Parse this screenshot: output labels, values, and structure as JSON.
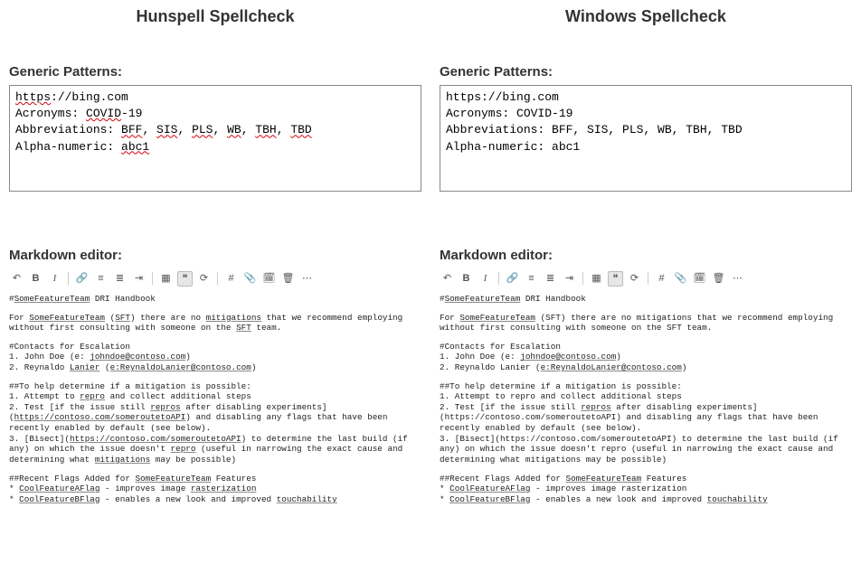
{
  "left": {
    "title": "Hunspell Spellcheck",
    "generic_label": "Generic Patterns:",
    "box": {
      "url_pre": "https",
      "url_post": "://bing.com",
      "acronyms_label": "Acronyms: ",
      "acr_word": "COVID",
      "acr_tail": "-19",
      "abbr_label": "Abbreviations: ",
      "abbr_bff": "BFF",
      "abbr_sis": "SIS",
      "abbr_pls": "PLS",
      "abbr_wb": "WB",
      "abbr_tbh": "TBH",
      "abbr_tbd": "TBD",
      "alpha_label": "Alpha-numeric: ",
      "alpha_val": "abc1"
    },
    "md_label": "Markdown editor:",
    "md": {
      "h1_pre": "#",
      "h1_team": "SomeFeatureTeam",
      "h1_rest": " DRI Handbook",
      "p1_a": "For ",
      "p1_team": "SomeFeatureTeam",
      "p1_b": " (",
      "p1_sft": "SFT",
      "p1_c": ") there are no ",
      "p1_mit": "mitigations",
      "p1_d": " that we recommend employing without first consulting with someone on the ",
      "p1_sft2": "SFT",
      "p1_e": " team.",
      "h2": "#Contacts for Escalation",
      "c1_a": "1. John Doe (e: ",
      "c1_mail": "johndoe@contoso.com",
      "c1_b": ")",
      "c2_a": "2. Reynaldo ",
      "c2_lanier": "Lanier",
      "c2_b": " (",
      "c2_mail": "e:ReynaldoLanier@contoso.com",
      "c2_c": ")",
      "h3": "##To help determine if a mitigation is possible:",
      "s1_a": "1. Attempt to ",
      "s1_repro": "repro",
      "s1_b": " and collect additional steps",
      "s2_a": "2. Test [if the issue still ",
      "s2_repros": "repros",
      "s2_b": " after disabling experiments](",
      "s2_url": "https://contoso.com/someroutetoAPI",
      "s2_c": ") and disabling any flags that have been recently enabled by default (see below).",
      "s3_a": "3. [Bisect](",
      "s3_url": "https://contoso.com/someroutetoAPI",
      "s3_b": ") to determine the last build (if any) on which the issue doesn't ",
      "s3_repro": "repro",
      "s3_c": " (useful in narrowing the exact cause and determining what ",
      "s3_mit": "mitigations",
      "s3_d": " may be possible)",
      "h4_a": "##Recent Flags Added for ",
      "h4_team": "SomeFeatureTeam",
      "h4_b": " Features",
      "f1_a": "* ",
      "f1_flag": "CoolFeatureAFlag",
      "f1_b": " - improves image ",
      "f1_rast": "rasterization",
      "f2_a": "* ",
      "f2_flag": "CoolFeatureBFlag",
      "f2_b": " - enables a new look and improved ",
      "f2_touch": "touchability"
    }
  },
  "right": {
    "title": "Windows Spellcheck",
    "generic_label": "Generic Patterns:",
    "box": {
      "url": "https://bing.com",
      "acronyms": "Acronyms: COVID-19",
      "abbr": "Abbreviations: BFF, SIS, PLS, WB, TBH, TBD",
      "alpha": "Alpha-numeric: abc1"
    },
    "md_label": "Markdown editor:",
    "md": {
      "h1_pre": "#",
      "h1_team": "SomeFeatureTeam",
      "h1_rest": " DRI Handbook",
      "p1_a": "For ",
      "p1_team": "SomeFeatureTeam",
      "p1_b": " (SFT) there are no mitigations that we recommend employing without first consulting with someone on the SFT team.",
      "h2": "#Contacts for Escalation",
      "c1_a": "1. John Doe (e: ",
      "c1_mail": "johndoe@contoso.com",
      "c1_b": ")",
      "c2_a": "2. Reynaldo Lanier (",
      "c2_mail": "e:ReynaldoLanier@contoso.com",
      "c2_b": ")",
      "h3": "##To help determine if a mitigation is possible:",
      "s1": "1. Attempt to repro and collect additional steps",
      "s2_a": "2. Test [if the issue still ",
      "s2_repros": "repros",
      "s2_b": " after disabling experiments](https://contoso.com/someroutetoAPI) and disabling any flags that have been recently enabled by default (see below).",
      "s3": "3. [Bisect](https://contoso.com/someroutetoAPI) to determine the last build (if any) on which the issue doesn't repro (useful in narrowing the exact cause and determining what mitigations may be possible)",
      "h4_a": "##Recent Flags Added for ",
      "h4_team": "SomeFeatureTeam",
      "h4_b": " Features",
      "f1_a": "* ",
      "f1_flag": "CoolFeatureAFlag",
      "f1_b": " - improves image rasterization",
      "f2_a": "* ",
      "f2_flag": "CoolFeatureBFlag",
      "f2_b": " - enables a new look and improved ",
      "f2_touch": "touchability"
    }
  },
  "toolbar": {
    "undo": "↶",
    "bold": "B",
    "italic": "I",
    "link": "🔗",
    "ul": "≡",
    "ol": "≣",
    "indent": "⇥",
    "table": "▦",
    "quote": "❝",
    "code": "⟳",
    "hash": "#",
    "paperclip": "📎",
    "date": "🗓",
    "trash": "🗑",
    "more": "⋯"
  }
}
